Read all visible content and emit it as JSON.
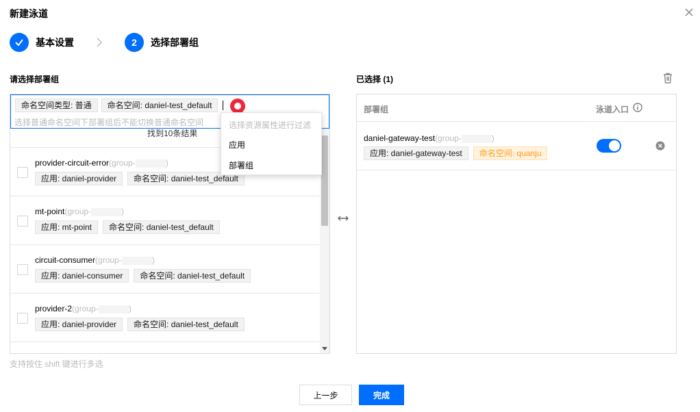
{
  "dialog": {
    "title": "新建泳道"
  },
  "steps": [
    {
      "label": "基本设置"
    },
    {
      "number": "2",
      "label": "选择部署组"
    }
  ],
  "left": {
    "label": "请选择部署组",
    "search_tags": [
      "命名空间类型: 普通",
      "命名空间: daniel-test_default"
    ],
    "search_placeholder": "选择普通命名空间下部署组后不能切换普通命名空间",
    "found_text": "找到10条结果",
    "dropdown": {
      "hint": "选择资源属性进行过滤",
      "items": [
        "应用",
        "部署组"
      ]
    },
    "rows": [
      {
        "name": "provider-circuit-error",
        "group": "(group-",
        "group_end": ")",
        "app": "应用: daniel-provider",
        "ns": "命名空间: daniel-test_default"
      },
      {
        "name": "mt-point",
        "group": "(group-",
        "group_end": ")",
        "app": "应用: mt-point",
        "ns": "命名空间: daniel-test_default"
      },
      {
        "name": "circuit-consumer",
        "group": "(group-",
        "group_end": ")",
        "app": "应用: daniel-consumer",
        "ns": "命名空间: daniel-test_default"
      },
      {
        "name": "provider-2",
        "group": "(group-",
        "group_end": ")",
        "app": "应用: daniel-provider",
        "ns": "命名空间: daniel-test_default"
      }
    ]
  },
  "right": {
    "label": "已选择 (1)",
    "col_group": "部署组",
    "col_entry": "泳道入口",
    "row": {
      "name": "daniel-gateway-test",
      "group": "(group-",
      "group_end": ")",
      "app": "应用: daniel-gateway-test",
      "ns": "命名空间: quanju",
      "entry_on": true
    }
  },
  "hint": "支持按住 shift 键进行多选",
  "buttons": {
    "prev": "上一步",
    "finish": "完成"
  },
  "colors": {
    "primary": "#006eff",
    "record": "#f0263a",
    "orange": "#ff9c19"
  }
}
